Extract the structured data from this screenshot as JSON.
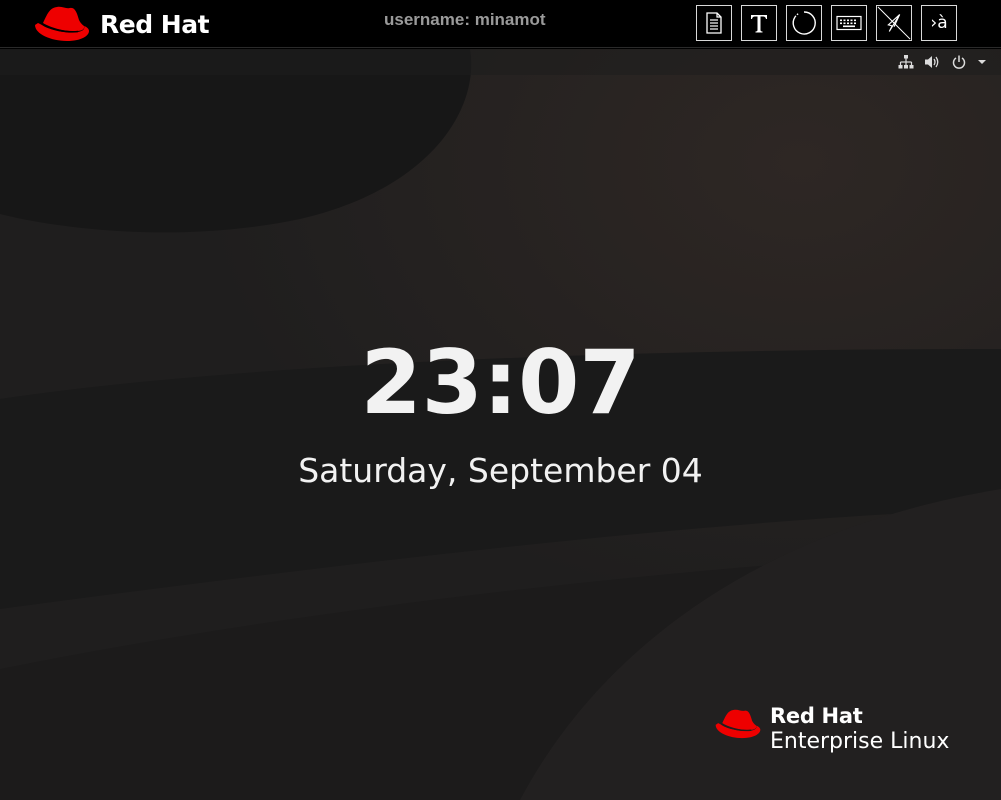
{
  "viewer": {
    "brand_text": "Red Hat",
    "username_label": "username: minamot",
    "brand_color": "#ee0000",
    "tools": [
      {
        "name": "clipboard-icon"
      },
      {
        "name": "text-input-icon"
      },
      {
        "name": "refresh-icon"
      },
      {
        "name": "keyboard-icon"
      },
      {
        "name": "no-pointer-icon"
      },
      {
        "name": "input-method-icon",
        "glyph": "›à"
      }
    ]
  },
  "topbar": {
    "tray_icons": [
      "network-wired-icon",
      "volume-icon",
      "power-icon",
      "chevron-down-icon"
    ]
  },
  "lockscreen": {
    "time": "23:07",
    "date": "Saturday, September 04"
  },
  "distro": {
    "vendor": "Red Hat",
    "product": "Enterprise Linux"
  }
}
